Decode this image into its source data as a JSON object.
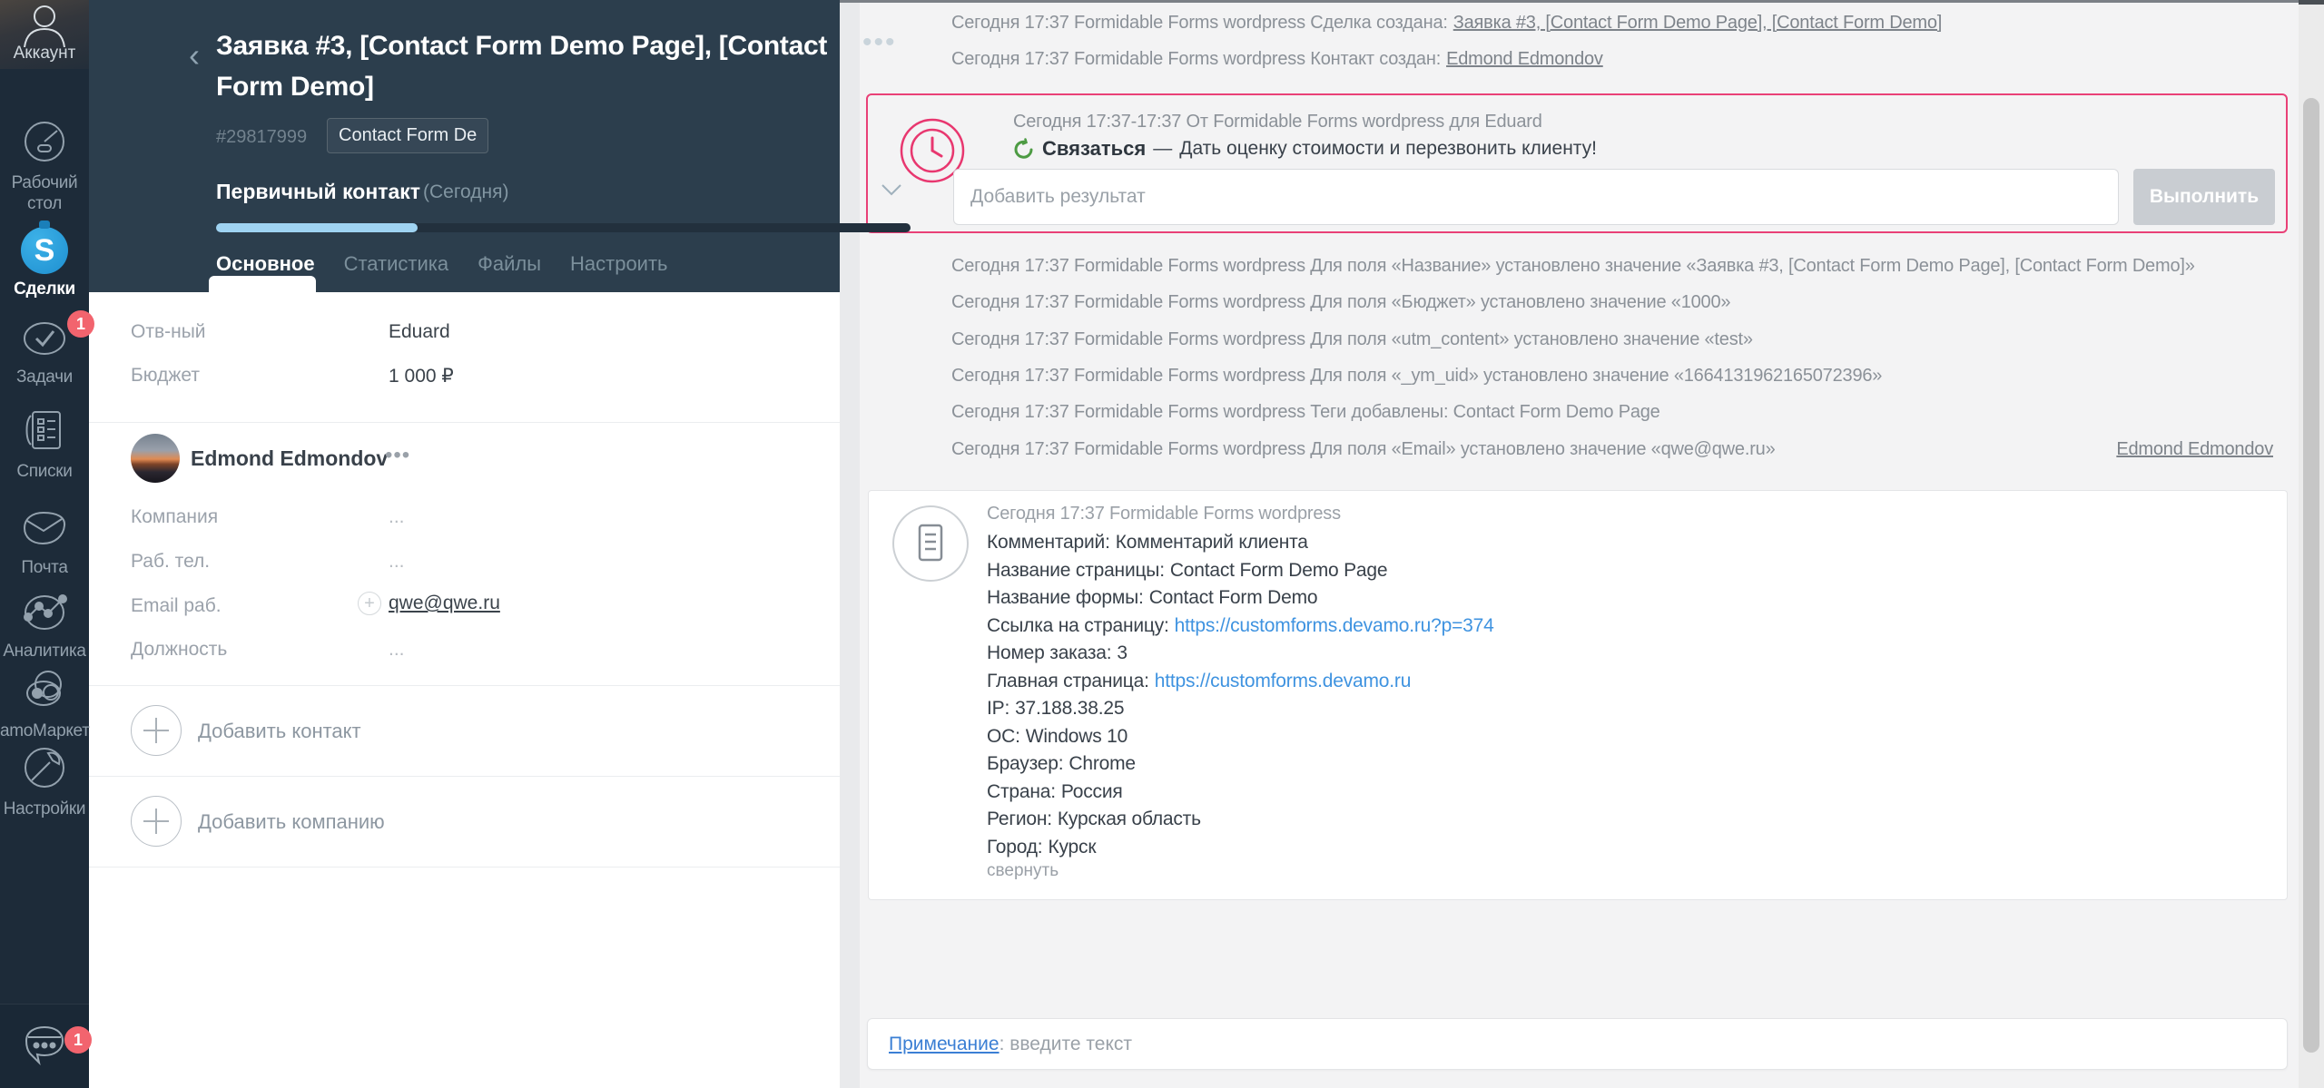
{
  "sidebar": {
    "account_label": "Аккаунт",
    "items": [
      {
        "label": "Рабочий стол",
        "icon": "dashboard-icon"
      },
      {
        "label": "Сделки",
        "icon": "deals-icon"
      },
      {
        "label": "Задачи",
        "icon": "tasks-icon",
        "badge": "1"
      },
      {
        "label": "Списки",
        "icon": "lists-icon"
      },
      {
        "label": "Почта",
        "icon": "mail-icon"
      },
      {
        "label": "Аналитика",
        "icon": "analytics-icon"
      },
      {
        "label": "amoМаркет",
        "icon": "market-icon"
      },
      {
        "label": "Настройки",
        "icon": "settings-icon"
      }
    ],
    "chat_badge": "1"
  },
  "lead": {
    "title": "Заявка #3, [Contact Form Demo Page], [Contact Form Demo]",
    "id": "#29817999",
    "tag": "Contact Form De",
    "pipeline_status": "Первичный контакт",
    "pipeline_date": "(Сегодня)",
    "progress_percent": 29,
    "tabs": [
      "Основное",
      "Статистика",
      "Файлы",
      "Настроить"
    ],
    "fields": [
      {
        "label": "Отв-ный",
        "value": "Eduard"
      },
      {
        "label": "Бюджет",
        "value": "1 000 ₽"
      }
    ],
    "contact": {
      "name": "Edmond Edmondov",
      "fields": [
        {
          "label": "Компания",
          "value": "..."
        },
        {
          "label": "Раб. тел.",
          "value": "..."
        },
        {
          "label": "Email раб.",
          "value": "qwe@qwe.ru"
        },
        {
          "label": "Должность",
          "value": "..."
        }
      ]
    },
    "add_contact": "Добавить контакт",
    "add_company": "Добавить компанию"
  },
  "feed": {
    "events_top": [
      {
        "prefix": "Сегодня 17:37 Formidable Forms wordpress Сделка создана:",
        "link": "Заявка #3, [Contact Form Demo Page], [Contact Form Demo]"
      },
      {
        "prefix": "Сегодня 17:37 Formidable Forms wordpress Контакт создан:",
        "link": "Edmond Edmondov"
      }
    ],
    "task": {
      "meta": "Сегодня 17:37-17:37 От Formidable Forms wordpress для Eduard",
      "type": "Связаться",
      "separator": "—",
      "text": "Дать оценку стоимости и перезвонить клиенту!",
      "result_placeholder": "Добавить результат",
      "complete_button": "Выполнить"
    },
    "events": [
      {
        "prefix": "Сегодня 17:37 Formidable Forms wordpress Для поля «Название» установлено значение «Заявка #3, [Contact Form Demo Page], [Contact Form Demo]»"
      },
      {
        "prefix": "Сегодня 17:37 Formidable Forms wordpress Для поля «Бюджет» установлено значение «1000»"
      },
      {
        "prefix": "Сегодня 17:37 Formidable Forms wordpress Для поля «utm_content» установлено значение «test»"
      },
      {
        "prefix": "Сегодня 17:37 Formidable Forms wordpress Для поля «_ym_uid» установлено значение «1664131962165072396»"
      },
      {
        "prefix": "Сегодня 17:37 Formidable Forms wordpress Теги добавлены: Contact Form Demo Page"
      },
      {
        "prefix": "Сегодня 17:37 Formidable Forms wordpress Для поля «Email» установлено значение «qwe@qwe.ru»",
        "right_link": "Edmond Edmondov"
      }
    ],
    "note": {
      "meta": "Сегодня 17:37 Formidable Forms wordpress",
      "lines": [
        {
          "label": "Комментарий:",
          "value": "Комментарий клиента"
        },
        {
          "label": "Название страницы:",
          "value": "Contact Form Demo Page"
        },
        {
          "label": "Название формы:",
          "value": "Contact Form Demo"
        },
        {
          "label": "Ссылка на страницу:",
          "value": "https://customforms.devamo.ru?p=374",
          "link": true
        },
        {
          "label": "Номер заказа:",
          "value": "3"
        },
        {
          "label": "Главная страница:",
          "value": "https://customforms.devamo.ru",
          "link": true
        },
        {
          "label": "IP:",
          "value": "37.188.38.25"
        },
        {
          "label": "ОС:",
          "value": "Windows 10"
        },
        {
          "label": "Браузер:",
          "value": "Chrome"
        },
        {
          "label": "Страна:",
          "value": "Россия"
        },
        {
          "label": "Регион:",
          "value": "Курская область"
        },
        {
          "label": "Город:",
          "value": "Курск"
        }
      ],
      "collapse": "свернуть"
    },
    "note_input": {
      "link_label": "Примечание",
      "placeholder": ": введите текст"
    }
  },
  "colors": {
    "accent_pink": "#e94077",
    "link_blue": "#3f93e0",
    "sidebar_bg": "#1d2b39",
    "header_bg": "#2c3e4d",
    "badge_red": "#f2646e",
    "progress_fill": "#9fd3f2",
    "deals_blue": "#29a0dc"
  }
}
